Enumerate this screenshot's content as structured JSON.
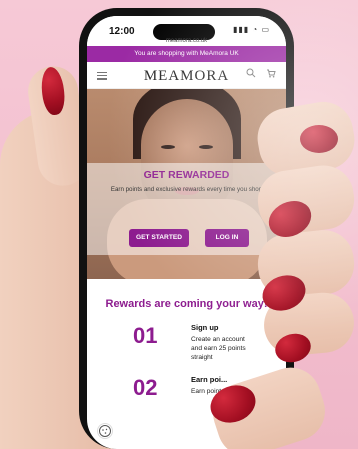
{
  "phone": {
    "status": {
      "time": "12:00"
    },
    "browser": {
      "url": "meamora.co.uk"
    },
    "site": {
      "promo_bar": "You are shopping with MeAmora UK",
      "logo": "MEAMORA",
      "hero": {
        "title": "GET REWARDED",
        "text": "Earn points and exclusive rewards every time you shop",
        "buttons": {
          "get_started": "GET STARTED",
          "log_in": "LOG IN"
        }
      },
      "rewards": {
        "title": "Rewards are coming your way!",
        "steps": [
          {
            "number": "01",
            "title": "Sign up",
            "description": "Create an account and earn 25 points straight"
          },
          {
            "number": "02",
            "title": "Earn poi...",
            "description": "Earn points"
          }
        ]
      }
    }
  },
  "colors": {
    "brand": "#8d1c8f",
    "background": "#f6c9d6",
    "nail": "#a30f22"
  },
  "icons": [
    "hamburger-icon",
    "search-icon",
    "cart-icon",
    "cookie-icon"
  ]
}
